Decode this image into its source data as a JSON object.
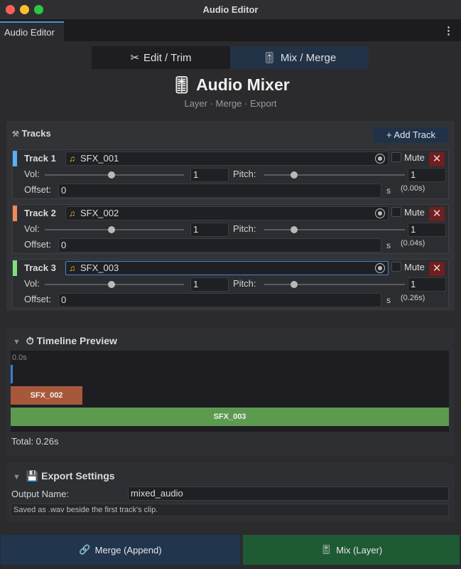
{
  "window": {
    "title": "Audio Editor",
    "tab": "Audio Editor",
    "kebab": "⋮"
  },
  "modes": {
    "edit": {
      "icon": "✂",
      "label": "Edit / Trim"
    },
    "mix": {
      "icon": "🎚",
      "label": "Mix / Merge"
    }
  },
  "header": {
    "icon": "🎚",
    "title": "Audio Mixer",
    "subtitle": "Layer · Merge · Export"
  },
  "tracks_section": {
    "icon": "⚒",
    "title": "Tracks",
    "add_label": "+ Add Track",
    "mute_label": "Mute",
    "delete_glyph": "✕",
    "vol_label": "Vol:",
    "pitch_label": "Pitch:",
    "offset_label": "Offset:",
    "offset_unit": "s",
    "tracks": [
      {
        "name": "Track 1",
        "color": "#5ab0f0",
        "clip": "SFX_001",
        "vol": "1",
        "vol_level": 0.48,
        "pitch": "1",
        "pitch_level": 0.21,
        "offset": "0",
        "computed": "(0.00s)"
      },
      {
        "name": "Track 2",
        "color": "#f08a5a",
        "clip": "SFX_002",
        "vol": "1",
        "vol_level": 0.48,
        "pitch": "1",
        "pitch_level": 0.21,
        "offset": "0",
        "computed": "(0.04s)"
      },
      {
        "name": "Track 3",
        "color": "#7ee07e",
        "clip": "SFX_003",
        "vol": "1",
        "vol_level": 0.48,
        "pitch": "1",
        "pitch_level": 0.21,
        "offset": "0",
        "computed": "(0.26s)"
      }
    ]
  },
  "timeline": {
    "icon": "⏱",
    "title": "Timeline Preview",
    "start_tick": "0.0s",
    "clips": [
      {
        "label": "",
        "color": "#3a7fd0"
      },
      {
        "label": "SFX_002",
        "color": "#a8583a"
      },
      {
        "label": "SFX_003",
        "color": "#5c9a50"
      }
    ],
    "total": "Total: 0.26s"
  },
  "export": {
    "icon": "💾",
    "title": "Export Settings",
    "output_label": "Output Name:",
    "output_value": "mixed_audio",
    "note": "Saved as .wav beside the first track's clip."
  },
  "actions": {
    "merge": {
      "icon": "🔗",
      "label": "Merge (Append)"
    },
    "mix": {
      "icon": "🎚",
      "label": "Mix (Layer)"
    }
  }
}
